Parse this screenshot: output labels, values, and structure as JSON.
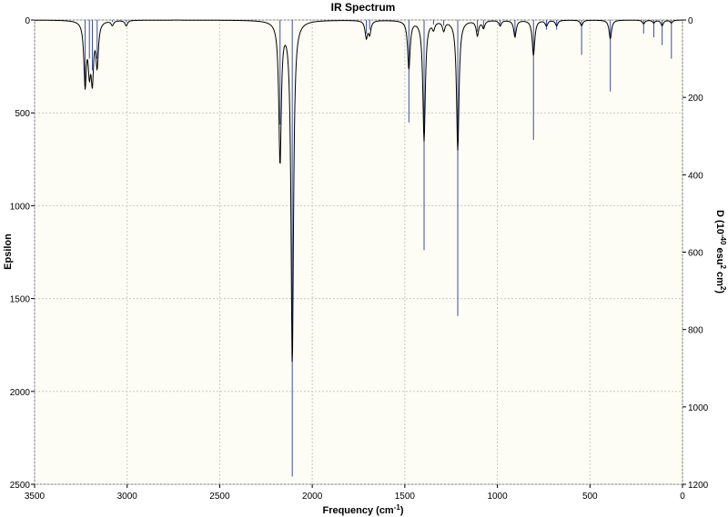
{
  "chart_data": {
    "type": "line",
    "title": "IR Spectrum",
    "xlabel": "Frequency (cm",
    "xlabel_sup": "-1",
    "xlabel_end": ")",
    "ylabel": "Epsilon",
    "ylabel_right": {
      "prefix": "D (10",
      "sup1": "-40",
      "mid": " esu",
      "sup2": "2",
      "mid2": " cm",
      "sup3": "2",
      "suffix": ")"
    },
    "xlim": [
      3500,
      0
    ],
    "ylim_left": [
      0,
      2500
    ],
    "ylim_right": [
      0,
      1200
    ],
    "x_ticks": [
      "3500",
      "3000",
      "2500",
      "2000",
      "1500",
      "1000",
      "500",
      "0"
    ],
    "y_ticks_left": [
      "0",
      "500",
      "1000",
      "1500",
      "2000",
      "2500"
    ],
    "y_ticks_right": [
      "0",
      "200",
      "400",
      "600",
      "800",
      "1000",
      "1200"
    ],
    "grid": true,
    "colors": {
      "background": "#fdfdf5",
      "curve": "#000000",
      "sticks": "#3a4fa6",
      "grid": "#c8c8c8"
    },
    "curve_width": 8,
    "series": [
      {
        "name": "Epsilon",
        "axis": "left",
        "render": "lorentzian-envelope",
        "peaks": [
          {
            "x": 3227,
            "y": 335
          },
          {
            "x": 3204,
            "y": 230
          },
          {
            "x": 3188,
            "y": 290
          },
          {
            "x": 3162,
            "y": 230
          },
          {
            "x": 3080,
            "y": 25
          },
          {
            "x": 3005,
            "y": 30
          },
          {
            "x": 2174,
            "y": 760
          },
          {
            "x": 2108,
            "y": 1850
          },
          {
            "x": 1708,
            "y": 90
          },
          {
            "x": 1690,
            "y": 70
          },
          {
            "x": 1478,
            "y": 260
          },
          {
            "x": 1396,
            "y": 650
          },
          {
            "x": 1345,
            "y": 40
          },
          {
            "x": 1290,
            "y": 50
          },
          {
            "x": 1214,
            "y": 700
          },
          {
            "x": 1108,
            "y": 80
          },
          {
            "x": 1075,
            "y": 40
          },
          {
            "x": 985,
            "y": 30
          },
          {
            "x": 905,
            "y": 90
          },
          {
            "x": 805,
            "y": 190
          },
          {
            "x": 735,
            "y": 30
          },
          {
            "x": 680,
            "y": 30
          },
          {
            "x": 545,
            "y": 30
          },
          {
            "x": 390,
            "y": 100
          },
          {
            "x": 210,
            "y": 20
          },
          {
            "x": 155,
            "y": 15
          },
          {
            "x": 110,
            "y": 30
          },
          {
            "x": 60,
            "y": 15
          }
        ]
      },
      {
        "name": "D",
        "axis": "right",
        "render": "sticks",
        "peaks": [
          {
            "x": 3227,
            "y": 160
          },
          {
            "x": 3204,
            "y": 100
          },
          {
            "x": 3188,
            "y": 130
          },
          {
            "x": 3162,
            "y": 100
          },
          {
            "x": 3080,
            "y": 5
          },
          {
            "x": 3005,
            "y": 6
          },
          {
            "x": 2174,
            "y": 270
          },
          {
            "x": 2108,
            "y": 1180
          },
          {
            "x": 1708,
            "y": 35
          },
          {
            "x": 1690,
            "y": 25
          },
          {
            "x": 1478,
            "y": 265
          },
          {
            "x": 1396,
            "y": 595
          },
          {
            "x": 1345,
            "y": 12
          },
          {
            "x": 1290,
            "y": 15
          },
          {
            "x": 1214,
            "y": 765
          },
          {
            "x": 1108,
            "y": 30
          },
          {
            "x": 1075,
            "y": 20
          },
          {
            "x": 985,
            "y": 12
          },
          {
            "x": 905,
            "y": 45
          },
          {
            "x": 805,
            "y": 310
          },
          {
            "x": 735,
            "y": 25
          },
          {
            "x": 680,
            "y": 25
          },
          {
            "x": 545,
            "y": 90
          },
          {
            "x": 390,
            "y": 185
          },
          {
            "x": 210,
            "y": 35
          },
          {
            "x": 155,
            "y": 45
          },
          {
            "x": 110,
            "y": 65
          },
          {
            "x": 60,
            "y": 100
          }
        ]
      }
    ]
  }
}
